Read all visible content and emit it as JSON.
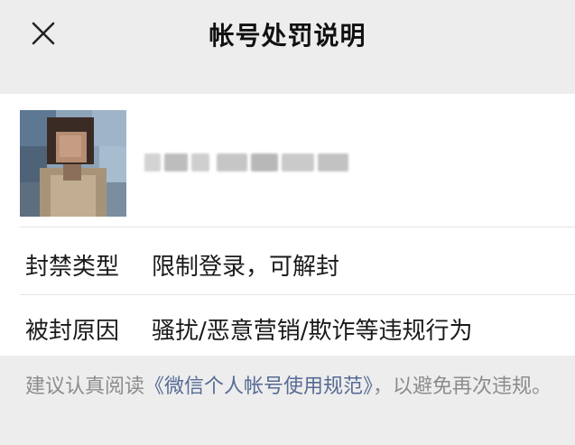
{
  "header": {
    "title": "帐号处罚说明",
    "close_icon": "close-icon"
  },
  "profile": {
    "avatar_icon": "avatar-blurred",
    "nickname_obscured": true
  },
  "details": [
    {
      "label": "封禁类型",
      "value": "限制登录，可解封"
    },
    {
      "label": "被封原因",
      "value": "骚扰/恶意营销/欺诈等违规行为"
    }
  ],
  "notice": {
    "prefix": "建议认真阅读",
    "link_text": "《微信个人帐号使用规范》",
    "suffix": "，以避免再次违规。"
  },
  "colors": {
    "background": "#ededed",
    "card": "#ffffff",
    "text": "#1a1a1a",
    "muted_text": "#8c8c8c",
    "link": "#576b95"
  }
}
